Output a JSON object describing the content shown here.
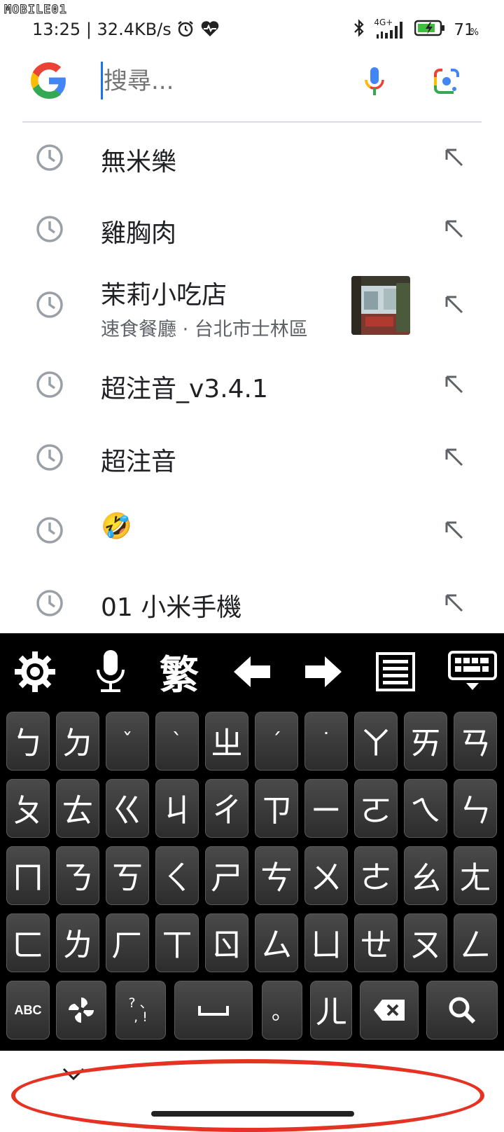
{
  "watermark": "MOBILE01",
  "status_bar": {
    "time": "13:25",
    "speed": "32.4KB/s",
    "network": "4G+",
    "battery": "71",
    "battery_unit": "%"
  },
  "search": {
    "placeholder": "搜尋..."
  },
  "suggestions": [
    {
      "text": "無米樂"
    },
    {
      "text": "雞胸肉"
    },
    {
      "text": "茉莉小吃店",
      "subtitle": "速食餐廳 · 台北市士林區"
    },
    {
      "text": "超注音_v3.4.1"
    },
    {
      "text": "超注音"
    },
    {
      "text": "🤣"
    },
    {
      "text": "01 小米手機"
    }
  ],
  "keyboard": {
    "toolbar": {
      "mode_label": "繁"
    },
    "row1": [
      "ㄅ",
      "ㄉ",
      "ˇ",
      "ˋ",
      "ㄓ",
      "ˊ",
      "˙",
      "ㄚ",
      "ㄞ",
      "ㄢ"
    ],
    "row2": [
      "ㄆ",
      "ㄊ",
      "ㄍ",
      "ㄐ",
      "ㄔ",
      "ㄗ",
      "ㄧ",
      "ㄛ",
      "ㄟ",
      "ㄣ"
    ],
    "row3": [
      "ㄇ",
      "ㄋ",
      "ㄎ",
      "ㄑ",
      "ㄕ",
      "ㄘ",
      "ㄨ",
      "ㄜ",
      "ㄠ",
      "ㄤ"
    ],
    "row4": [
      "ㄈ",
      "ㄌ",
      "ㄏ",
      "ㄒ",
      "ㄖ",
      "ㄙ",
      "ㄩ",
      "ㄝ",
      "ㄡ",
      "ㄥ"
    ],
    "bottom": {
      "abc_label": "ABC",
      "punct_label_top": "? 、",
      "punct_label_bottom": ", !",
      "period_label": "。",
      "er_label": "ㄦ"
    }
  },
  "colors": {
    "google_blue": "#4285F4",
    "google_red": "#EA4335",
    "google_yellow": "#FBBC05",
    "google_green": "#34A853",
    "annotation_red": "#e53222"
  }
}
